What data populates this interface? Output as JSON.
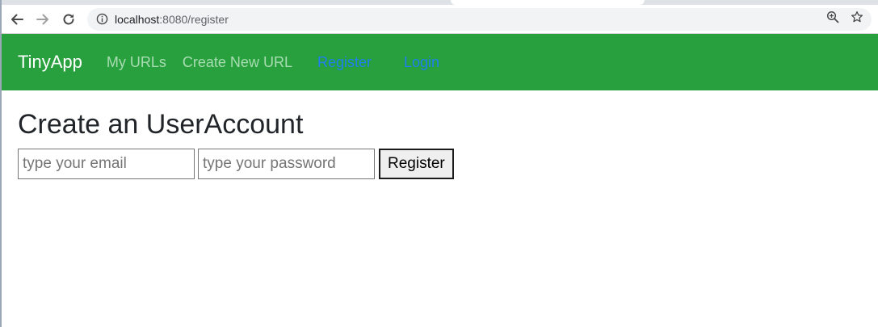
{
  "browser": {
    "url_host": "localhost",
    "url_path": ":8080/register"
  },
  "navbar": {
    "brand": "TinyApp",
    "links": [
      {
        "label": "My URLs"
      },
      {
        "label": "Create New URL"
      },
      {
        "label": "Register"
      },
      {
        "label": "Login"
      }
    ],
    "colors": {
      "background": "#28a03d",
      "muted_link": "#a8dcb2",
      "active_link": "#1e7ef2"
    }
  },
  "main": {
    "title": "Create an UserAccount",
    "email_placeholder": "type your email",
    "password_placeholder": "type your password",
    "submit_label": "Register"
  }
}
